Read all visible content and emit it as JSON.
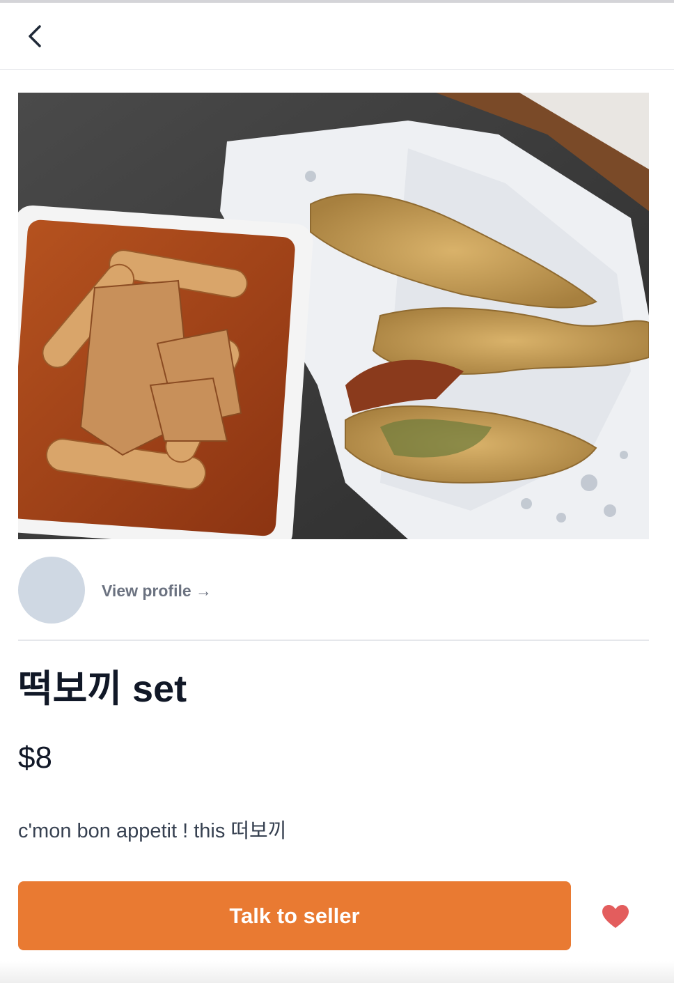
{
  "header": {
    "back_icon": "chevron-left-icon"
  },
  "listing": {
    "photo_description_icon": "food-photo",
    "seller": {
      "view_profile_label": "View profile →"
    },
    "title": "떡보끼 set",
    "price": "$8",
    "description": "c'mon bon appetit ! this 떠보끼"
  },
  "actions": {
    "talk_label": "Talk to seller",
    "favorite_icon": "heart-icon"
  },
  "colors": {
    "accent": "#e97a32",
    "heart": "#e35d5d",
    "avatar": "#cfd8e3"
  }
}
